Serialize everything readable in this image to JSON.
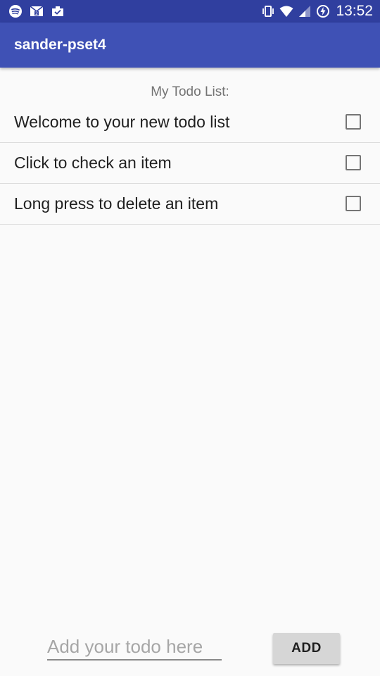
{
  "status_bar": {
    "time": "13:52",
    "left_icons": [
      "spotify-icon",
      "gmail-notification-icon",
      "inbox-icon"
    ],
    "right_icons": [
      "vibrate-icon",
      "wifi-icon",
      "cell-signal-icon",
      "battery-charging-icon"
    ]
  },
  "app_bar": {
    "title": "sander-pset4"
  },
  "list": {
    "heading": "My Todo List:",
    "items": [
      {
        "text": "Welcome to your new todo list",
        "checked": false
      },
      {
        "text": "Click to check an item",
        "checked": false
      },
      {
        "text": "Long press to delete an item",
        "checked": false
      }
    ]
  },
  "composer": {
    "placeholder": "Add your todo here",
    "value": "",
    "add_label": "ADD"
  },
  "colors": {
    "status_bar": "#303f9f",
    "app_bar": "#3f51b5",
    "background": "#fafafa"
  }
}
